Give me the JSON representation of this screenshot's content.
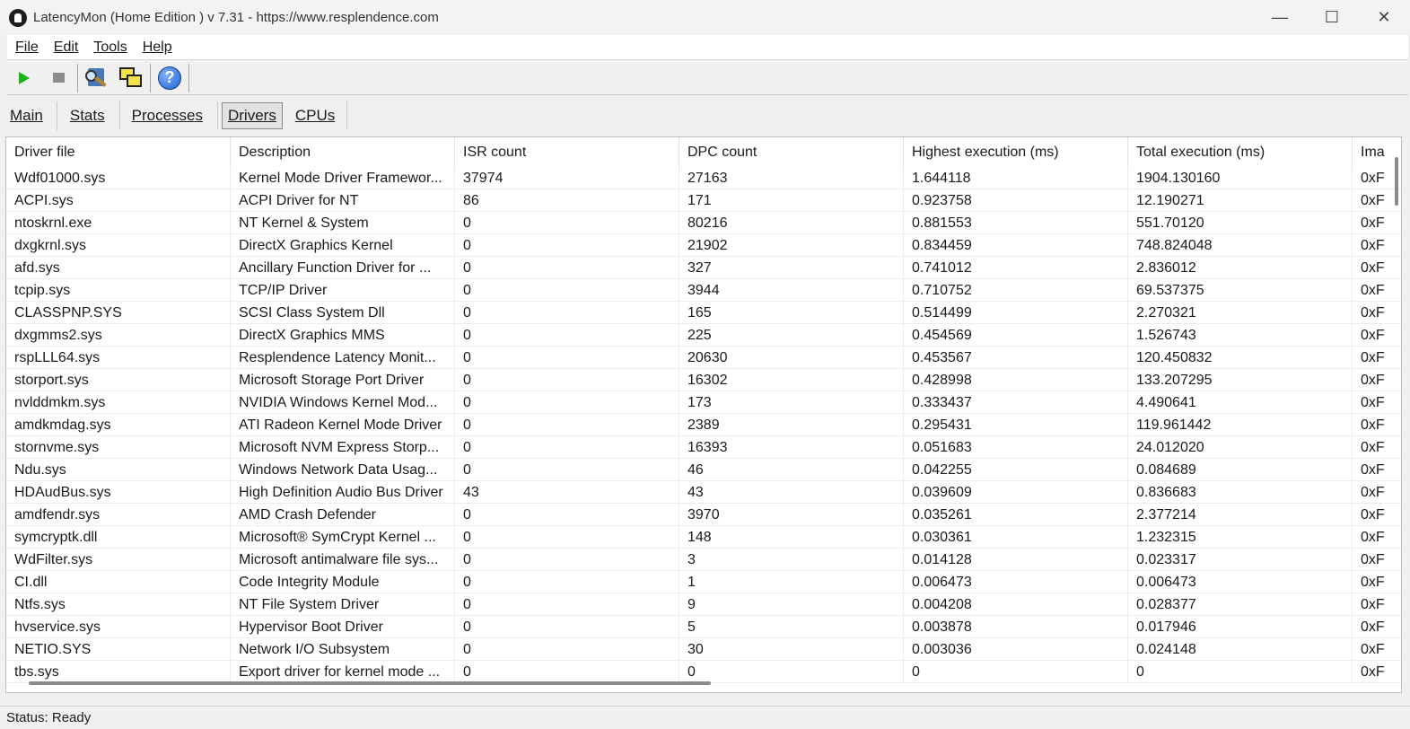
{
  "window": {
    "title": "LatencyMon  (Home Edition )  v 7.31 - https://www.resplendence.com",
    "controls": [
      "minimize-icon",
      "maximize-icon",
      "close-icon"
    ]
  },
  "menu": {
    "items": [
      {
        "label": "File"
      },
      {
        "label": "Edit"
      },
      {
        "label": "Tools"
      },
      {
        "label": "Help"
      }
    ]
  },
  "toolbar": {
    "buttons": [
      "play-icon",
      "stop-icon",
      "analyze-icon",
      "windows-icon",
      "help-icon"
    ],
    "help_glyph": "?"
  },
  "tabs": [
    {
      "label": "Main",
      "active": false
    },
    {
      "label": "Stats",
      "active": false
    },
    {
      "label": "Processes",
      "active": false
    },
    {
      "label": "Drivers",
      "active": true
    },
    {
      "label": "CPUs",
      "active": false
    }
  ],
  "table": {
    "columns": [
      "Driver file",
      "Description",
      "ISR count",
      "DPC count",
      "Highest execution (ms)",
      "Total execution (ms)",
      "Ima"
    ],
    "rows": [
      [
        "Wdf01000.sys",
        "Kernel Mode Driver Framewor...",
        "37974",
        "27163",
        "1.644118",
        "1904.130160",
        "0xF"
      ],
      [
        "ACPI.sys",
        "ACPI Driver for NT",
        "86",
        "171",
        "0.923758",
        "12.190271",
        "0xF"
      ],
      [
        "ntoskrnl.exe",
        "NT Kernel & System",
        "0",
        "80216",
        "0.881553",
        "551.70120",
        "0xF"
      ],
      [
        "dxgkrnl.sys",
        "DirectX Graphics Kernel",
        "0",
        "21902",
        "0.834459",
        "748.824048",
        "0xF"
      ],
      [
        "afd.sys",
        "Ancillary Function Driver for ...",
        "0",
        "327",
        "0.741012",
        "2.836012",
        "0xF"
      ],
      [
        "tcpip.sys",
        "TCP/IP Driver",
        "0",
        "3944",
        "0.710752",
        "69.537375",
        "0xF"
      ],
      [
        "CLASSPNP.SYS",
        "SCSI Class System Dll",
        "0",
        "165",
        "0.514499",
        "2.270321",
        "0xF"
      ],
      [
        "dxgmms2.sys",
        "DirectX Graphics MMS",
        "0",
        "225",
        "0.454569",
        "1.526743",
        "0xF"
      ],
      [
        "rspLLL64.sys",
        "Resplendence Latency Monit...",
        "0",
        "20630",
        "0.453567",
        "120.450832",
        "0xF"
      ],
      [
        "storport.sys",
        "Microsoft Storage Port Driver",
        "0",
        "16302",
        "0.428998",
        "133.207295",
        "0xF"
      ],
      [
        "nvlddmkm.sys",
        "NVIDIA Windows Kernel Mod...",
        "0",
        "173",
        "0.333437",
        "4.490641",
        "0xF"
      ],
      [
        "amdkmdag.sys",
        "ATI Radeon Kernel Mode Driver",
        "0",
        "2389",
        "0.295431",
        "119.961442",
        "0xF"
      ],
      [
        "stornvme.sys",
        "Microsoft NVM Express Storp...",
        "0",
        "16393",
        "0.051683",
        "24.012020",
        "0xF"
      ],
      [
        "Ndu.sys",
        "Windows Network Data Usag...",
        "0",
        "46",
        "0.042255",
        "0.084689",
        "0xF"
      ],
      [
        "HDAudBus.sys",
        "High Definition Audio Bus Driver",
        "43",
        "43",
        "0.039609",
        "0.836683",
        "0xF"
      ],
      [
        "amdfendr.sys",
        "AMD Crash Defender",
        "0",
        "3970",
        "0.035261",
        "2.377214",
        "0xF"
      ],
      [
        "symcryptk.dll",
        "Microsoft® SymCrypt Kernel ...",
        "0",
        "148",
        "0.030361",
        "1.232315",
        "0xF"
      ],
      [
        "WdFilter.sys",
        "Microsoft antimalware file sys...",
        "0",
        "3",
        "0.014128",
        "0.023317",
        "0xF"
      ],
      [
        "CI.dll",
        "Code Integrity Module",
        "0",
        "1",
        "0.006473",
        "0.006473",
        "0xF"
      ],
      [
        "Ntfs.sys",
        "NT File System Driver",
        "0",
        "9",
        "0.004208",
        "0.028377",
        "0xF"
      ],
      [
        "hvservice.sys",
        "Hypervisor Boot Driver",
        "0",
        "5",
        "0.003878",
        "0.017946",
        "0xF"
      ],
      [
        "NETIO.SYS",
        "Network I/O Subsystem",
        "0",
        "30",
        "0.003036",
        "0.024148",
        "0xF"
      ],
      [
        "tbs.sys",
        "Export driver for kernel mode ...",
        "0",
        "0",
        "0",
        "0",
        "0xF"
      ]
    ]
  },
  "status": {
    "text": "Status: Ready"
  }
}
